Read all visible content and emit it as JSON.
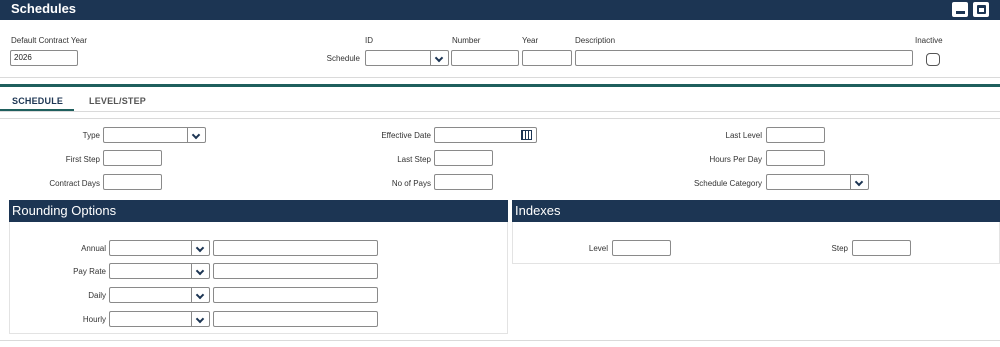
{
  "window": {
    "title": "Schedules"
  },
  "header": {
    "default_contract_year_label": "Default Contract Year",
    "default_contract_year_value": "2026",
    "schedule_label": "Schedule",
    "id_label": "ID",
    "number_label": "Number",
    "year_label": "Year",
    "description_label": "Description",
    "inactive_label": "Inactive"
  },
  "tabs": [
    {
      "label": "SCHEDULE",
      "active": true
    },
    {
      "label": "LEVEL/STEP",
      "active": false
    }
  ],
  "form": {
    "type_label": "Type",
    "first_step_label": "First Step",
    "contract_days_label": "Contract Days",
    "effective_date_label": "Effective Date",
    "last_step_label": "Last Step",
    "no_of_pays_label": "No of Pays",
    "last_level_label": "Last Level",
    "hours_per_day_label": "Hours Per Day",
    "schedule_category_label": "Schedule Category"
  },
  "rounding": {
    "title": "Rounding Options",
    "rows": [
      {
        "label": "Annual"
      },
      {
        "label": "Pay Rate"
      },
      {
        "label": "Daily"
      },
      {
        "label": "Hourly"
      }
    ]
  },
  "indexes": {
    "title": "Indexes",
    "level_label": "Level",
    "step_label": "Step"
  },
  "colors": {
    "header_navy": "#1c3553",
    "accent_teal": "#1f5f5d"
  }
}
